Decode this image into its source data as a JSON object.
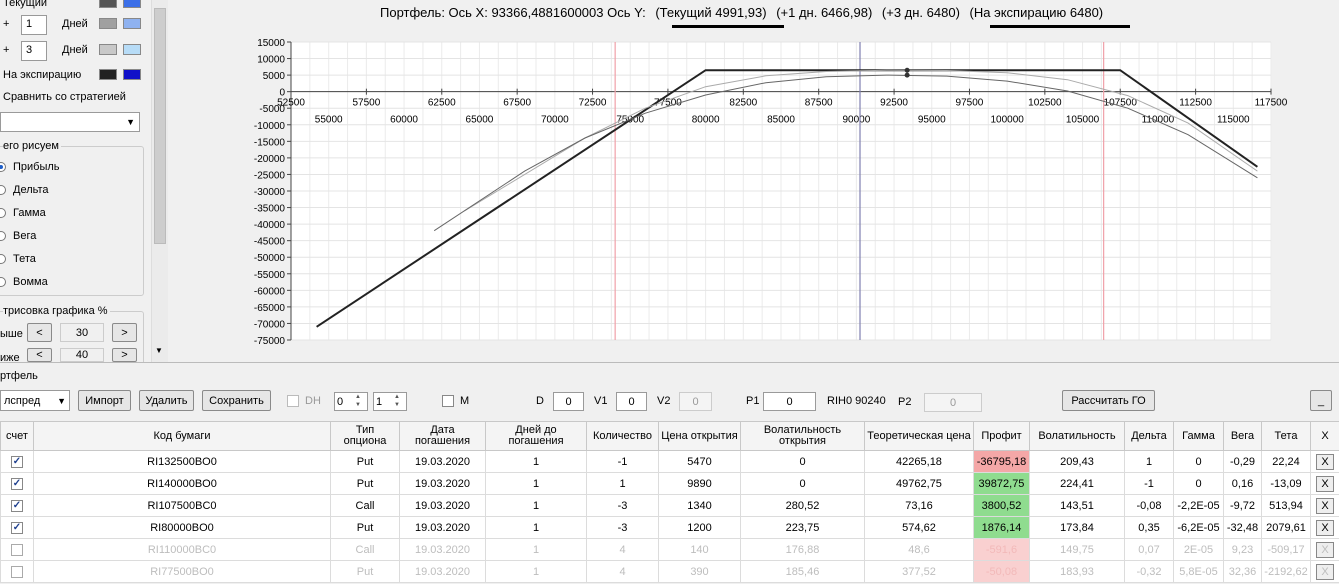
{
  "left": {
    "lines": [
      {
        "label": "Текущий",
        "sign": "",
        "days": "",
        "c1": "#555555",
        "c2": "#3b6fe8"
      },
      {
        "label": "Дней",
        "sign": "+",
        "days": "1",
        "c1": "#a0a0a0",
        "c2": "#8fb2f0"
      },
      {
        "label": "Дней",
        "sign": "+",
        "days": "3",
        "c1": "#c8c8c8",
        "c2": "#b7dcf7"
      },
      {
        "label": "На экспирацию",
        "sign": "",
        "days": "",
        "c1": "#222222",
        "c2": "#1010c8"
      }
    ],
    "compare_label": "Сравнить со стратегией",
    "compare_value": "",
    "draw_group_title": "его рисуем",
    "radios": [
      "Прибыль",
      "Дельта",
      "Гамма",
      "Вега",
      "Тета",
      "Вомма"
    ],
    "selected_radio": "Прибыль",
    "render_title": "трисовка графика %",
    "above_label": "ыше",
    "above_value": "30",
    "below_label": "иже",
    "below_value": "40",
    "prev": "<",
    "next": ">"
  },
  "chart_title": {
    "prefix": "Портфель: Ось X: 93366,4881600003 Ось Y:",
    "current": "(Текущий 4991,93)",
    "plus1": "(+1 дн. 6466,98)",
    "plus3": "(+3 дн. 6480)",
    "expiry": "(На экспирацию 6480)"
  },
  "chart_data": {
    "type": "line",
    "x_ticks_top": [
      "52500",
      "57500",
      "62500",
      "67500",
      "72500",
      "77500",
      "82500",
      "87500",
      "92500",
      "97500",
      "102500",
      "107500",
      "112500",
      "117500"
    ],
    "x_ticks_bottom": [
      "55000",
      "60000",
      "65000",
      "70000",
      "75000",
      "80000",
      "85000",
      "90000",
      "95000",
      "100000",
      "105000",
      "110000",
      "115000"
    ],
    "y_ticks": [
      "15000",
      "10000",
      "5000",
      "0",
      "-5000",
      "-10000",
      "-15000",
      "-20000",
      "-25000",
      "-30000",
      "-35000",
      "-40000",
      "-45000",
      "-50000",
      "-55000",
      "-60000",
      "-65000",
      "-70000",
      "-75000"
    ],
    "xlim": [
      52500,
      117500
    ],
    "ylim": [
      -75000,
      15000
    ],
    "vlines": [
      {
        "x": 74000,
        "color": "#f0a0a8"
      },
      {
        "x": 90240,
        "color": "#8080b0"
      },
      {
        "x": 106400,
        "color": "#f0a0a8"
      }
    ],
    "series": [
      {
        "color": "#222222",
        "width": 2,
        "x": [
          54200,
          80000,
          107500,
          116600
        ],
        "y": [
          -71000,
          6480,
          6480,
          -22700
        ]
      },
      {
        "color": "#aaaaaa",
        "width": 1,
        "x": [
          64000,
          72000,
          76000,
          80000,
          84000,
          88000,
          92000,
          96000,
          100000,
          104000,
          108000,
          112000,
          116600
        ],
        "y": [
          -36000,
          -14000,
          -5000,
          1500,
          4800,
          6100,
          6470,
          6400,
          5700,
          3600,
          -1200,
          -9500,
          -24000
        ]
      },
      {
        "color": "#666666",
        "width": 1,
        "x": [
          62000,
          68000,
          72000,
          76000,
          80000,
          84000,
          88000,
          92000,
          96000,
          100000,
          104000,
          108000,
          112000,
          116600
        ],
        "y": [
          -42000,
          -24000,
          -14000,
          -6500,
          -1000,
          2700,
          4500,
          5000,
          4700,
          3200,
          200,
          -5000,
          -13000,
          -26000
        ]
      }
    ],
    "markers": [
      {
        "x": 93366,
        "y": 6466
      },
      {
        "x": 93366,
        "y": 4991
      }
    ]
  },
  "portfolio": {
    "group_label": "ртфель",
    "strategy": "лспред",
    "import_label": "Импорт",
    "delete_label": "Удалить",
    "save_label": "Сохранить",
    "dh_label": "DH",
    "spin1": "0",
    "spin2": "1",
    "m_label": "M",
    "d_label": "D",
    "d_value": "0",
    "v1_label": "V1",
    "v1_value": "0",
    "v2_label": "V2",
    "v2_value": "0",
    "p1_label": "P1",
    "p1_value": "0",
    "underlying": "RIH0 90240",
    "p2_label": "P2",
    "p2_value": "0",
    "calc_go_label": "Рассчитать ГО",
    "minimize_label": "_"
  },
  "table": {
    "headers": [
      "счет",
      "Код бумаги",
      "Тип опциона",
      "Дата погашения",
      "Дней до погашения",
      "Количество",
      "Цена открытия",
      "Волатильность открытия",
      "Теоретическая цена",
      "Профит",
      "Волатильность",
      "Дельта",
      "Гамма",
      "Вега",
      "Тета",
      "X"
    ],
    "rows": [
      {
        "checked": true,
        "dim": false,
        "cells": [
          "RI132500BO0",
          "Put",
          "19.03.2020",
          "1",
          "-1",
          "5470",
          "0",
          "42265,18",
          "-36795,18",
          "209,43",
          "1",
          "0",
          "-0,29",
          "22,24"
        ],
        "profit_sign": "neg"
      },
      {
        "checked": true,
        "dim": false,
        "cells": [
          "RI140000BO0",
          "Put",
          "19.03.2020",
          "1",
          "1",
          "9890",
          "0",
          "49762,75",
          "39872,75",
          "224,41",
          "-1",
          "0",
          "0,16",
          "-13,09"
        ],
        "profit_sign": "pos"
      },
      {
        "checked": true,
        "dim": false,
        "cells": [
          "RI107500BC0",
          "Call",
          "19.03.2020",
          "1",
          "-3",
          "1340",
          "280,52",
          "73,16",
          "3800,52",
          "143,51",
          "-0,08",
          "-2,2E-05",
          "-9,72",
          "513,94"
        ],
        "profit_sign": "pos"
      },
      {
        "checked": true,
        "dim": false,
        "cells": [
          "RI80000BO0",
          "Put",
          "19.03.2020",
          "1",
          "-3",
          "1200",
          "223,75",
          "574,62",
          "1876,14",
          "173,84",
          "0,35",
          "-6,2E-05",
          "-32,48",
          "2079,61"
        ],
        "profit_sign": "pos"
      },
      {
        "checked": false,
        "dim": true,
        "cells": [
          "RI110000BC0",
          "Call",
          "19.03.2020",
          "1",
          "4",
          "140",
          "176,88",
          "48,6",
          "-591,6",
          "149,75",
          "0,07",
          "2E-05",
          "9,23",
          "-509,17"
        ],
        "profit_sign": "neg"
      },
      {
        "checked": false,
        "dim": true,
        "cells": [
          "RI77500BO0",
          "Put",
          "19.03.2020",
          "1",
          "4",
          "390",
          "185,46",
          "377,52",
          "-50,08",
          "183,93",
          "-0,32",
          "5,8E-05",
          "32,36",
          "-2192,62"
        ],
        "profit_sign": "neg"
      }
    ],
    "x": "X"
  }
}
